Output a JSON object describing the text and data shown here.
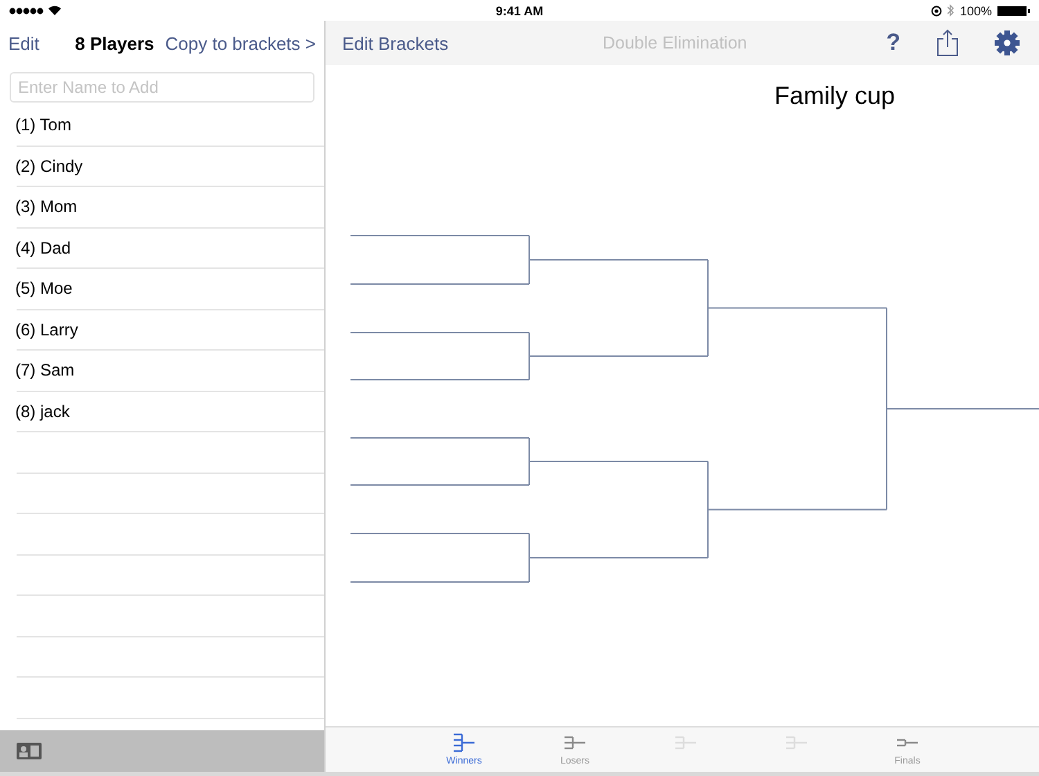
{
  "status_bar": {
    "time": "9:41 AM",
    "battery": "100%"
  },
  "players_pane": {
    "edit": "Edit",
    "title": "8 Players",
    "copy": "Copy to brackets >",
    "placeholder": "Enter Name to Add",
    "players": [
      "(1) Tom",
      "(2) Cindy",
      "(3) Mom",
      "(4) Dad",
      "(5) Moe",
      "(6) Larry",
      "(7) Sam",
      "(8) jack"
    ]
  },
  "bracket_pane": {
    "edit": "Edit Brackets",
    "title": "Double Elimination",
    "help": "?",
    "bracket_title": "Family cup"
  },
  "tabs": [
    {
      "kind": "winners",
      "label": "Winners",
      "selected": true,
      "disabled": false
    },
    {
      "kind": "losers",
      "label": "Losers",
      "selected": false,
      "disabled": false
    },
    {
      "kind": "losers",
      "selected": false,
      "disabled": true
    },
    {
      "kind": "losers",
      "selected": false,
      "disabled": true
    },
    {
      "kind": "finals",
      "label": "Finals",
      "selected": false,
      "disabled": false
    }
  ]
}
